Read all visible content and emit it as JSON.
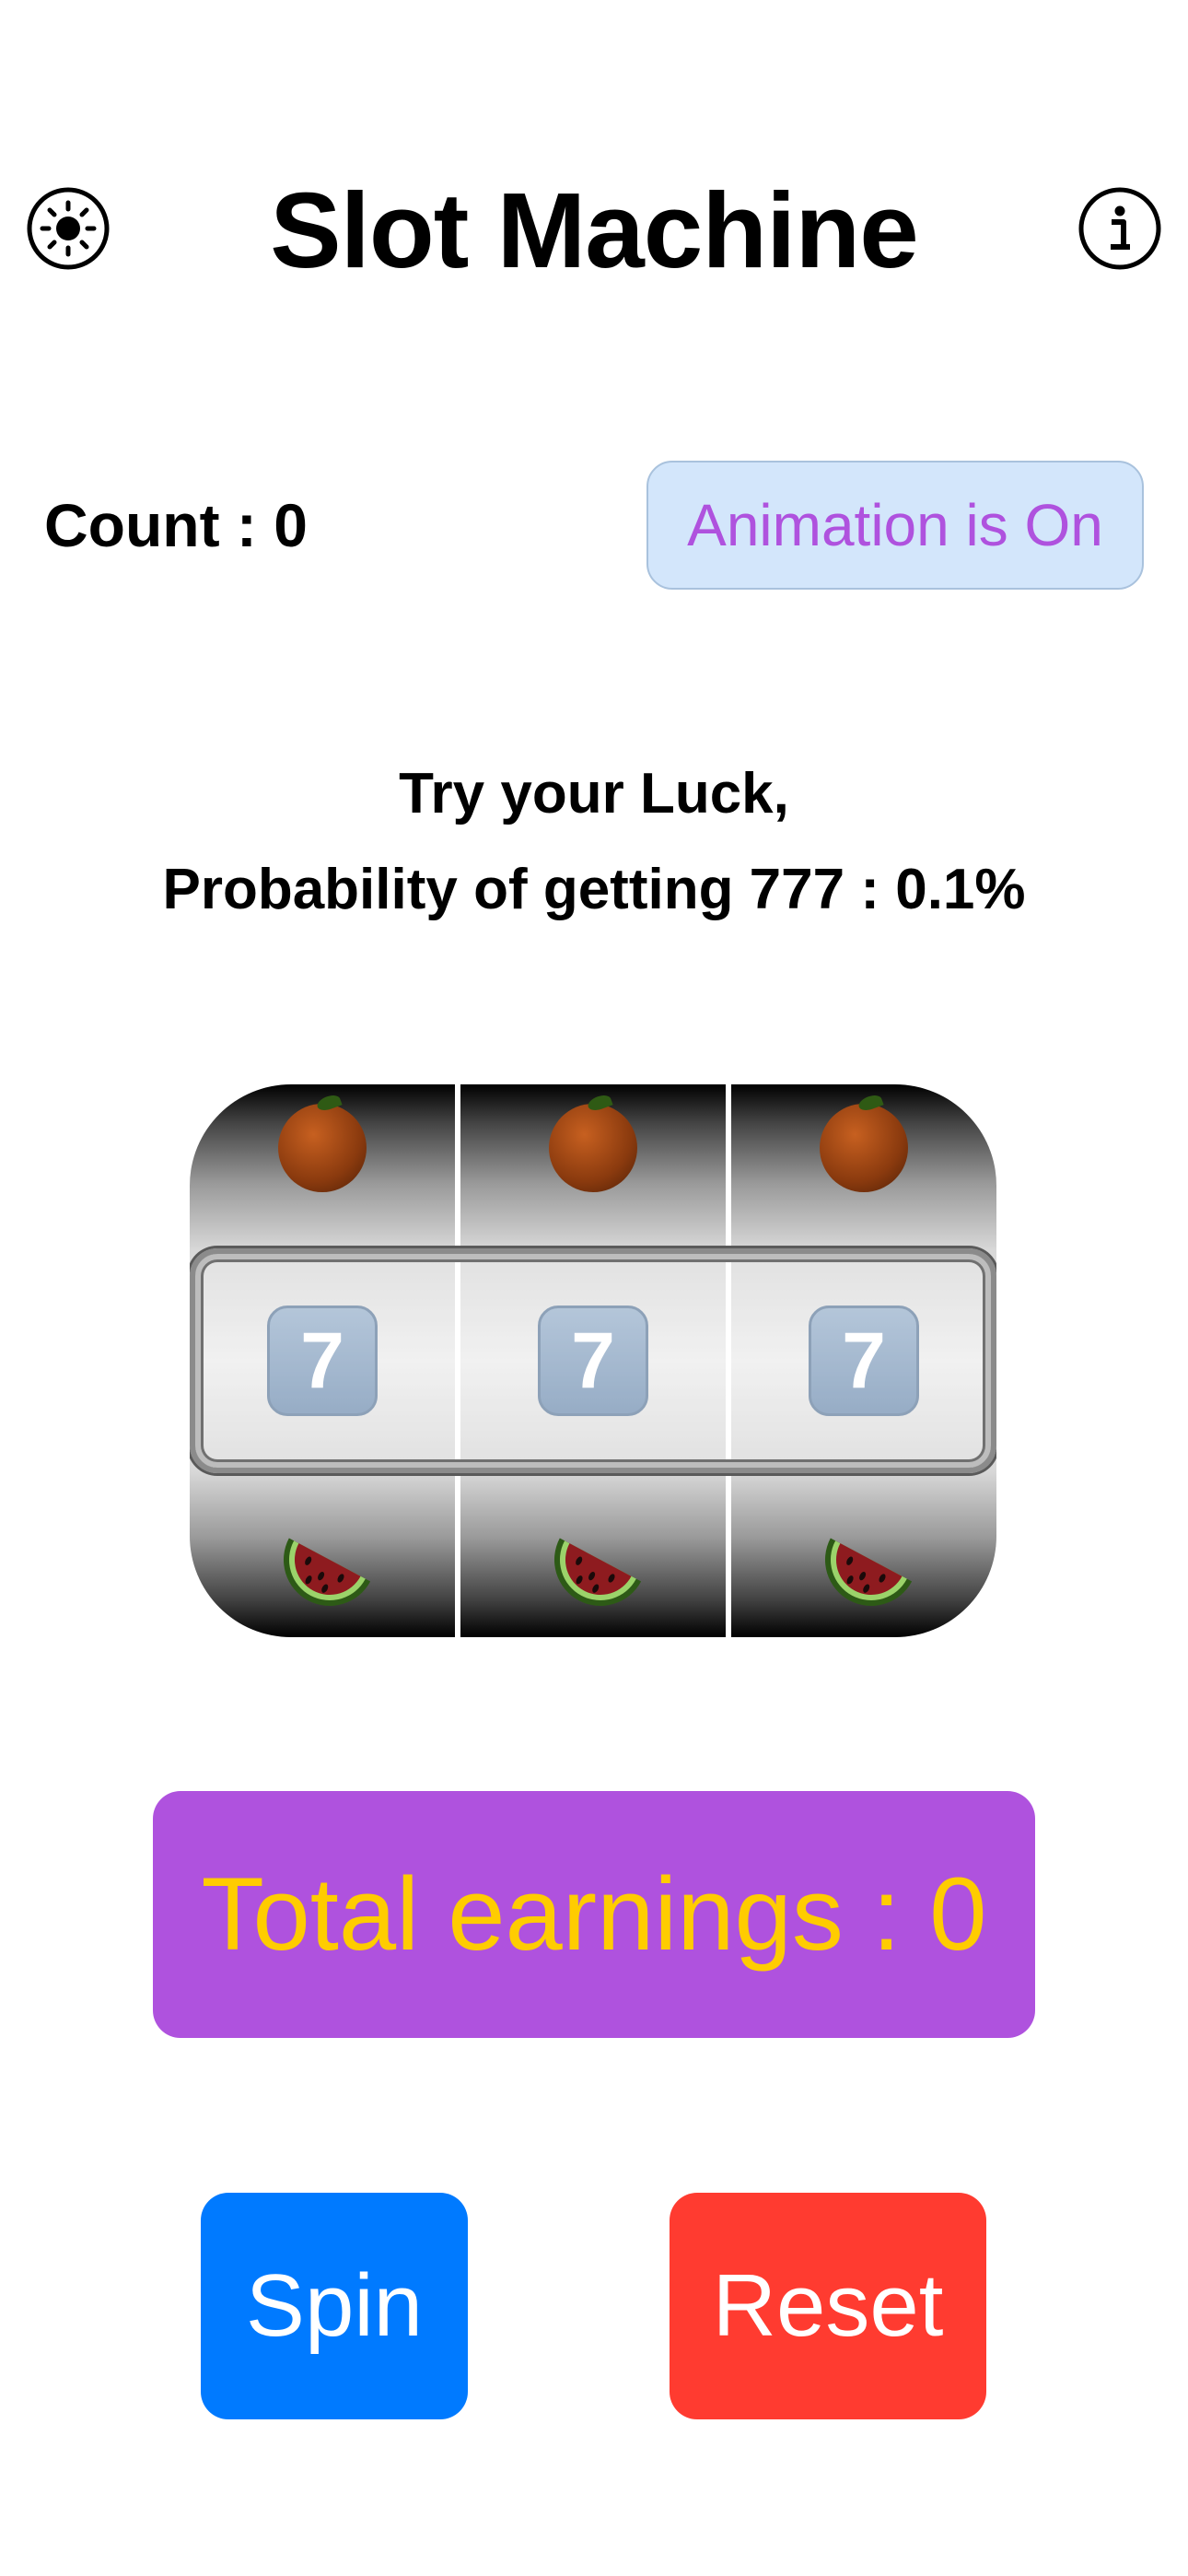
{
  "header": {
    "title": "Slot Machine",
    "left_icon": "sun-icon",
    "right_icon": "info-icon"
  },
  "status": {
    "count_label": "Count : 0",
    "animation_toggle_label": "Animation is On"
  },
  "tagline": {
    "line1": "Try your Luck,",
    "line2": "Probability of getting 777 : 0.1%"
  },
  "slot": {
    "reels": [
      {
        "top": "orange",
        "middle": "7",
        "bottom": "watermelon"
      },
      {
        "top": "orange",
        "middle": "7",
        "bottom": "watermelon"
      },
      {
        "top": "orange",
        "middle": "7",
        "bottom": "watermelon"
      }
    ]
  },
  "earnings": {
    "label": "Total earnings : 0"
  },
  "buttons": {
    "spin_label": "Spin",
    "reset_label": "Reset"
  },
  "colors": {
    "accent_purple": "#af52de",
    "earnings_text": "#ffcc00",
    "spin_blue": "#007aff",
    "reset_red": "#ff3b30",
    "pill_bg": "#d3e6fb"
  }
}
